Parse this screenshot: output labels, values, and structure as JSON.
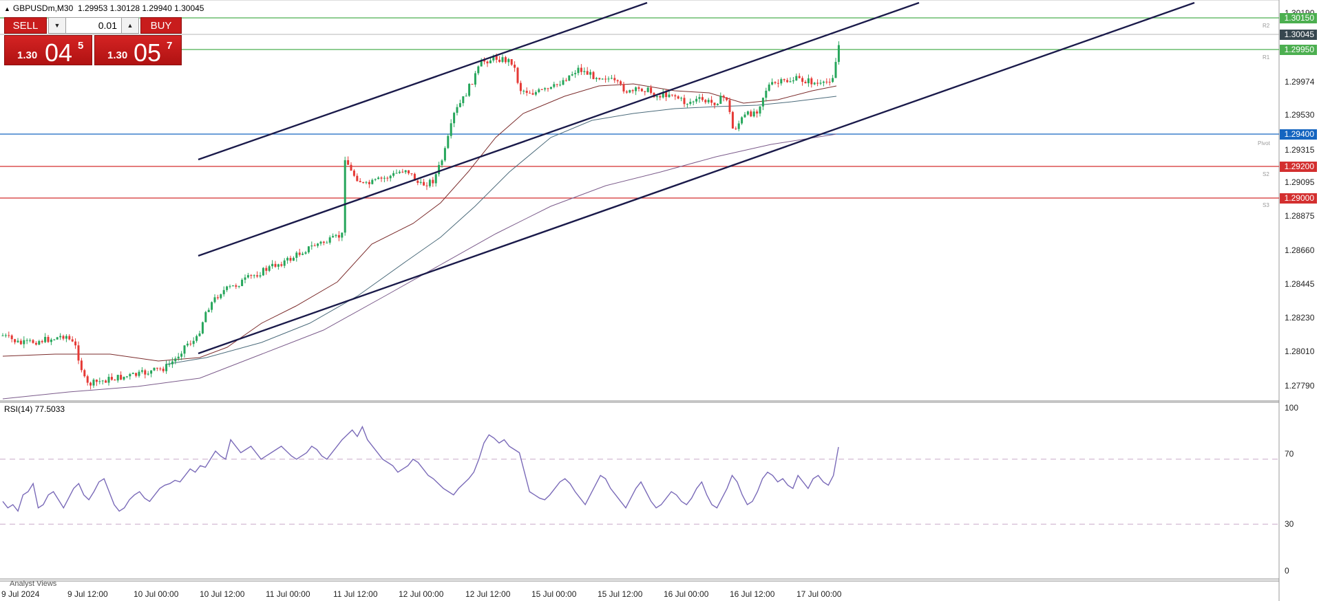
{
  "header": {
    "symbol_timeframe": "GBPUSDm,M30",
    "ohlc": "1.29953 1.30128 1.29940 1.30045"
  },
  "trade_panel": {
    "sell_label": "SELL",
    "buy_label": "BUY",
    "volume_value": "0.01",
    "sell_price": {
      "small": "1.30",
      "big": "04",
      "sup": "5"
    },
    "buy_price": {
      "small": "1.30",
      "big": "05",
      "sup": "7"
    }
  },
  "price_axis": {
    "labels": [
      "1.30190",
      "1.29974",
      "1.29530",
      "1.29315",
      "1.29095",
      "1.28875",
      "1.28660",
      "1.28445",
      "1.28230",
      "1.28010",
      "1.27790"
    ]
  },
  "level_boxes": [
    {
      "label": "1.30150",
      "color": "#4caf50"
    },
    {
      "label": "1.30045",
      "color": "#37474f"
    },
    {
      "label": "1.29950",
      "color": "#4caf50"
    },
    {
      "label": "1.29400",
      "color": "#1565c0"
    },
    {
      "label": "1.29200",
      "color": "#d32f2f"
    },
    {
      "label": "1.29000",
      "color": "#d32f2f"
    }
  ],
  "level_tags": [
    "R2",
    "R1",
    "Pivot",
    "S2",
    "S3"
  ],
  "rsi": {
    "label": "RSI(14) 77.5033",
    "ticks": [
      "100",
      "70",
      "30",
      "0"
    ],
    "values": [
      44,
      40,
      42,
      38,
      48,
      50,
      55,
      40,
      42,
      48,
      50,
      45,
      40,
      46,
      52,
      55,
      48,
      45,
      50,
      56,
      58,
      50,
      42,
      38,
      40,
      45,
      48,
      50,
      46,
      44,
      48,
      52,
      54,
      55,
      57,
      56,
      60,
      64,
      62,
      66,
      65,
      70,
      75,
      72,
      70,
      82,
      78,
      74,
      76,
      78,
      74,
      70,
      72,
      74,
      76,
      78,
      75,
      72,
      70,
      72,
      74,
      78,
      76,
      72,
      70,
      74,
      78,
      82,
      85,
      88,
      84,
      90,
      82,
      78,
      74,
      70,
      68,
      66,
      62,
      64,
      66,
      70,
      68,
      64,
      60,
      58,
      55,
      52,
      50,
      48,
      52,
      55,
      58,
      62,
      70,
      80,
      85,
      83,
      80,
      82,
      78,
      76,
      74,
      62,
      50,
      48,
      46,
      45,
      48,
      52,
      56,
      58,
      55,
      50,
      46,
      42,
      48,
      54,
      60,
      58,
      52,
      48,
      44,
      40,
      46,
      52,
      56,
      50,
      44,
      40,
      42,
      46,
      50,
      48,
      44,
      42,
      46,
      52,
      56,
      48,
      42,
      40,
      46,
      52,
      60,
      56,
      48,
      42,
      44,
      50,
      58,
      62,
      60,
      56,
      58,
      54,
      52,
      60,
      56,
      52,
      58,
      60,
      56,
      54,
      60,
      77.5
    ],
    "overbought": 70,
    "oversold": 30
  },
  "time_axis": {
    "labels": [
      "9 Jul 2024",
      "9 Jul 12:00",
      "10 Jul 00:00",
      "10 Jul 12:00",
      "11 Jul 00:00",
      "11 Jul 12:00",
      "12 Jul 00:00",
      "12 Jul 12:00",
      "15 Jul 00:00",
      "15 Jul 12:00",
      "16 Jul 00:00",
      "16 Jul 12:00",
      "17 Jul 00:00"
    ]
  },
  "bottom_tab": {
    "label": "Analyst Views"
  },
  "colors": {
    "bull": "#26a65b",
    "bear": "#e53935",
    "channel": "#1a1a4a",
    "ma_fast": "#7a2a2a",
    "ma_mid": "#4a6a7a",
    "ma_slow": "#7a5a8a",
    "rsi_line": "#7a6ab8"
  }
}
